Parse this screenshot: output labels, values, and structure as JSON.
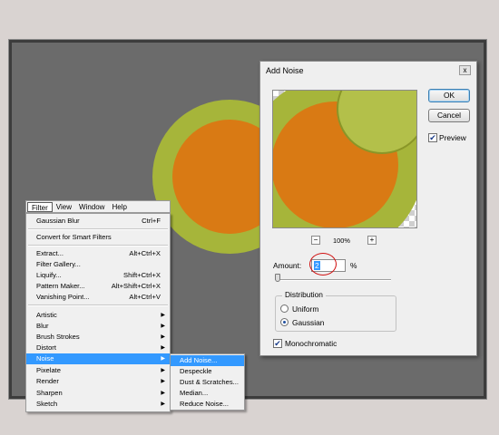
{
  "menubar": {
    "items": [
      "Filter",
      "View",
      "Window",
      "Help"
    ]
  },
  "filter_menu": {
    "items": [
      {
        "label": "Gaussian Blur",
        "shortcut": "Ctrl+F"
      },
      {
        "label": "Convert for Smart Filters",
        "shortcut": ""
      },
      {
        "label": "Extract...",
        "shortcut": "Alt+Ctrl+X"
      },
      {
        "label": "Filter Gallery...",
        "shortcut": ""
      },
      {
        "label": "Liquify...",
        "shortcut": "Shift+Ctrl+X"
      },
      {
        "label": "Pattern Maker...",
        "shortcut": "Alt+Shift+Ctrl+X"
      },
      {
        "label": "Vanishing Point...",
        "shortcut": "Alt+Ctrl+V"
      },
      {
        "label": "Artistic",
        "submenu": true
      },
      {
        "label": "Blur",
        "submenu": true
      },
      {
        "label": "Brush Strokes",
        "submenu": true
      },
      {
        "label": "Distort",
        "submenu": true
      },
      {
        "label": "Noise",
        "submenu": true,
        "highlighted": true
      },
      {
        "label": "Pixelate",
        "submenu": true
      },
      {
        "label": "Render",
        "submenu": true
      },
      {
        "label": "Sharpen",
        "submenu": true
      },
      {
        "label": "Sketch",
        "submenu": true
      }
    ]
  },
  "noise_submenu": {
    "items": [
      {
        "label": "Add Noise...",
        "highlighted": true
      },
      {
        "label": "Despeckle"
      },
      {
        "label": "Dust & Scratches..."
      },
      {
        "label": "Median..."
      },
      {
        "label": "Reduce Noise..."
      }
    ]
  },
  "dialog": {
    "title": "Add Noise",
    "close_glyph": "x",
    "ok_label": "OK",
    "cancel_label": "Cancel",
    "preview_label": "Preview",
    "preview_checked": true,
    "zoom_out": "−",
    "zoom_in": "+",
    "zoom_level": "100%",
    "amount_label": "Amount:",
    "amount_value": "2",
    "amount_unit": "%",
    "amount_slider_fraction": 0.02,
    "distribution_title": "Distribution",
    "distribution_options": [
      "Uniform",
      "Gaussian"
    ],
    "distribution_selected": "Gaussian",
    "monochromatic_label": "Monochromatic",
    "monochromatic_checked": true
  },
  "colors": {
    "canvas": "#6b6b6b",
    "sticker_green": "#a6b53a",
    "sticker_orange": "#d97a14",
    "highlight": "#3399ff"
  }
}
